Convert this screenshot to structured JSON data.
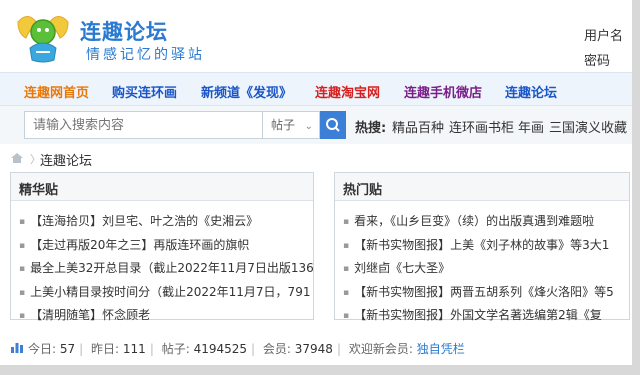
{
  "header": {
    "site_title": "连趣论坛",
    "slogan": "情感记忆的驿站",
    "user_label": "用户名",
    "password_label": "密码"
  },
  "nav": {
    "items": [
      {
        "label": "连趣网首页",
        "color": "#e8780c"
      },
      {
        "label": "购买连环画",
        "color": "#1a56c8"
      },
      {
        "label": "新频道《发现》",
        "color": "#1a56c8"
      },
      {
        "label": "连趣淘宝网",
        "color": "#d62020"
      },
      {
        "label": "连趣手机微店",
        "color": "#7a1f8a"
      },
      {
        "label": "连趣论坛",
        "color": "#1a56c8"
      }
    ]
  },
  "search": {
    "placeholder": "请输入搜索内容",
    "type": "帖子",
    "hot_label": "热搜:",
    "hot_items": [
      "精品百种",
      "连环画书柜",
      "年画",
      "三国演义收藏"
    ]
  },
  "breadcrumb": {
    "current": "连趣论坛"
  },
  "featured": {
    "title": "精华贴",
    "items": [
      "【连海拾贝】刘旦宅、叶之浩的《史湘云》",
      "【走过再版20年之三】再版连环画的旗帜",
      "最全上美32开总目录（截止2022年11月7日出版136",
      "上美小精目录按时间分（截止2022年11月7日，791",
      "【清明随笔】怀念顾老"
    ]
  },
  "hot": {
    "title": "热门贴",
    "items": [
      "看来，《山乡巨变》（续）的出版真遇到难题啦",
      "【新书实物图报】上美《刘子林的故事》等3大1",
      "刘继卣《七大圣》",
      "【新书实物图报】两晋五胡系列《烽火洛阳》等5",
      "【新书实物图报】外国文学名著选编第2辑《复"
    ]
  },
  "stats": {
    "today_label": "今日:",
    "today": "57",
    "yesterday_label": "昨日:",
    "yesterday": "111",
    "posts_label": "帖子:",
    "posts": "4194525",
    "members_label": "会员:",
    "members": "37948",
    "welcome_label": "欢迎新会员:",
    "new_member": "独自凭栏"
  }
}
